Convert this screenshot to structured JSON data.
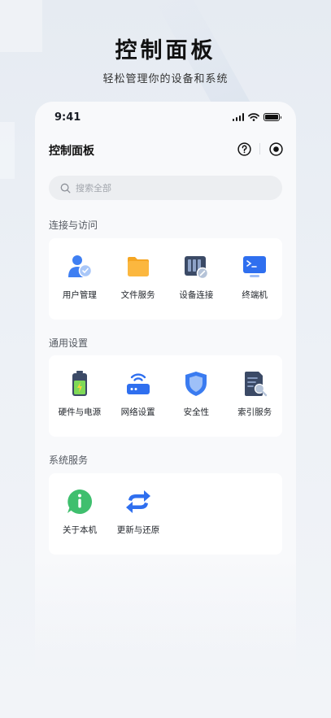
{
  "hero": {
    "title": "控制面板",
    "subtitle": "轻松管理你的设备和系统"
  },
  "status_bar": {
    "time": "9:41"
  },
  "header": {
    "title": "控制面板",
    "help_icon": "help-icon",
    "record_icon": "target-icon"
  },
  "search": {
    "placeholder": "搜索全部",
    "value": ""
  },
  "sections": [
    {
      "title": "连接与访问",
      "items": [
        {
          "label": "用户管理",
          "icon": "user-icon"
        },
        {
          "label": "文件服务",
          "icon": "folder-icon"
        },
        {
          "label": "设备连接",
          "icon": "nas-icon"
        },
        {
          "label": "终端机",
          "icon": "terminal-icon"
        }
      ]
    },
    {
      "title": "通用设置",
      "items": [
        {
          "label": "硬件与电源",
          "icon": "battery-icon"
        },
        {
          "label": "网络设置",
          "icon": "router-icon"
        },
        {
          "label": "安全性",
          "icon": "shield-icon"
        },
        {
          "label": "索引服务",
          "icon": "index-search-icon"
        }
      ]
    },
    {
      "title": "系统服务",
      "items": [
        {
          "label": "关于本机",
          "icon": "info-icon"
        },
        {
          "label": "更新与还原",
          "icon": "refresh-icon"
        }
      ]
    }
  ],
  "colors": {
    "accent": "#3a7bf0",
    "text": "#1f2329",
    "card": "#ffffff",
    "background": "#e9edf3"
  }
}
